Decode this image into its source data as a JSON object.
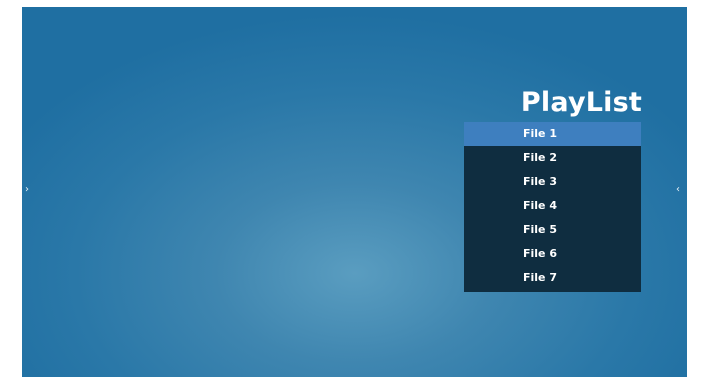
{
  "navigation": {
    "left_arrow": "›",
    "right_arrow": "‹"
  },
  "playlist": {
    "title": "PlayList",
    "selected_index": 0,
    "items": [
      {
        "label": "File 1"
      },
      {
        "label": "File 2"
      },
      {
        "label": "File 3"
      },
      {
        "label": "File 4"
      },
      {
        "label": "File 5"
      },
      {
        "label": "File 6"
      },
      {
        "label": "File 7"
      }
    ]
  },
  "colors": {
    "background": "#2a78a8",
    "panel": "#0f2d40",
    "selected_item": "#3e7fbf",
    "text": "#ffffff"
  }
}
